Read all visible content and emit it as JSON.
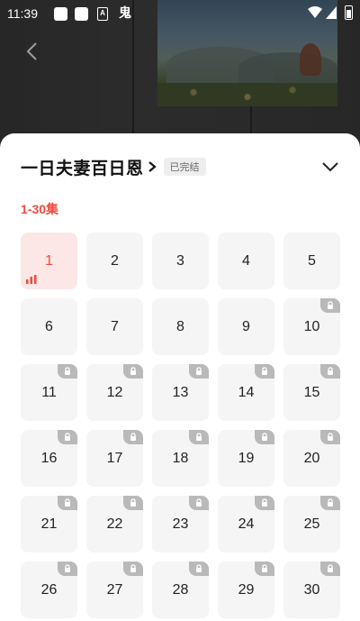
{
  "status_bar": {
    "time": "11:39",
    "icon_a_label": "A",
    "icon_glyph": "鬼"
  },
  "sheet": {
    "title": "一日夫妻百日恩",
    "status_badge": "已完结",
    "range_label": "1-30集",
    "current_episode": 1,
    "episodes": [
      {
        "label": "1",
        "locked": false,
        "active": true
      },
      {
        "label": "2",
        "locked": false,
        "active": false
      },
      {
        "label": "3",
        "locked": false,
        "active": false
      },
      {
        "label": "4",
        "locked": false,
        "active": false
      },
      {
        "label": "5",
        "locked": false,
        "active": false
      },
      {
        "label": "6",
        "locked": false,
        "active": false
      },
      {
        "label": "7",
        "locked": false,
        "active": false
      },
      {
        "label": "8",
        "locked": false,
        "active": false
      },
      {
        "label": "9",
        "locked": false,
        "active": false
      },
      {
        "label": "10",
        "locked": true,
        "active": false
      },
      {
        "label": "11",
        "locked": true,
        "active": false
      },
      {
        "label": "12",
        "locked": true,
        "active": false
      },
      {
        "label": "13",
        "locked": true,
        "active": false
      },
      {
        "label": "14",
        "locked": true,
        "active": false
      },
      {
        "label": "15",
        "locked": true,
        "active": false
      },
      {
        "label": "16",
        "locked": true,
        "active": false
      },
      {
        "label": "17",
        "locked": true,
        "active": false
      },
      {
        "label": "18",
        "locked": true,
        "active": false
      },
      {
        "label": "19",
        "locked": true,
        "active": false
      },
      {
        "label": "20",
        "locked": true,
        "active": false
      },
      {
        "label": "21",
        "locked": true,
        "active": false
      },
      {
        "label": "22",
        "locked": true,
        "active": false
      },
      {
        "label": "23",
        "locked": true,
        "active": false
      },
      {
        "label": "24",
        "locked": true,
        "active": false
      },
      {
        "label": "25",
        "locked": true,
        "active": false
      },
      {
        "label": "26",
        "locked": true,
        "active": false
      },
      {
        "label": "27",
        "locked": true,
        "active": false
      },
      {
        "label": "28",
        "locked": true,
        "active": false
      },
      {
        "label": "29",
        "locked": true,
        "active": false
      },
      {
        "label": "30",
        "locked": true,
        "active": false
      }
    ]
  },
  "icons": {
    "back": "back-chevron-icon",
    "title_chevron": "chevron-right-icon",
    "collapse": "chevron-down-icon",
    "lock": "lock-icon",
    "playing": "playing-bars-icon",
    "wifi": "wifi-icon",
    "signal": "cell-signal-icon",
    "battery": "battery-icon"
  },
  "colors": {
    "accent": "#f04b3e",
    "active_bg": "#fde6e6",
    "tile_bg": "#f5f5f5",
    "lock_bg": "#b9b9b9"
  }
}
